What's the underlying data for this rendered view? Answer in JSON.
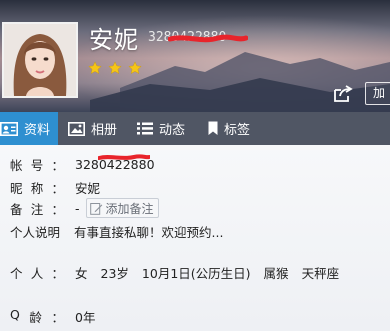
{
  "profile": {
    "nickname": "安妮",
    "qq_number": "3280422880",
    "stars": 3,
    "add_button_label": "加"
  },
  "tabs": [
    {
      "label": "资料",
      "icon": "profile-card-icon",
      "active": true
    },
    {
      "label": "相册",
      "icon": "photo-album-icon",
      "active": false
    },
    {
      "label": "动态",
      "icon": "feed-list-icon",
      "active": false
    },
    {
      "label": "标签",
      "icon": "bookmark-icon",
      "active": false
    }
  ],
  "info": {
    "account_label": "帐号：",
    "account_label_chars": [
      "帐",
      "号",
      "："
    ],
    "account_value": "3280422880",
    "nickname_label_chars": [
      "昵",
      "称",
      "："
    ],
    "nickname_value": "安妮",
    "remark_label_chars": [
      "备",
      "注",
      "："
    ],
    "remark_value": "-",
    "add_remark_label": "添加备注",
    "bio_label": "个人说明",
    "bio_value": "有事直接私聊！欢迎预约...",
    "person_label_chars": [
      "个",
      "人",
      "："
    ],
    "person_items": [
      "女",
      "23岁",
      "10月1日(公历生日)",
      "属猴",
      "天秤座"
    ],
    "qage_label_chars": [
      "Q",
      "龄",
      "："
    ],
    "qage_value": "0年"
  },
  "colors": {
    "tab_active": "#2e8fd0",
    "tab_bar": "#3a4050",
    "star": "#f5c518",
    "redaction": "#e8242b"
  }
}
